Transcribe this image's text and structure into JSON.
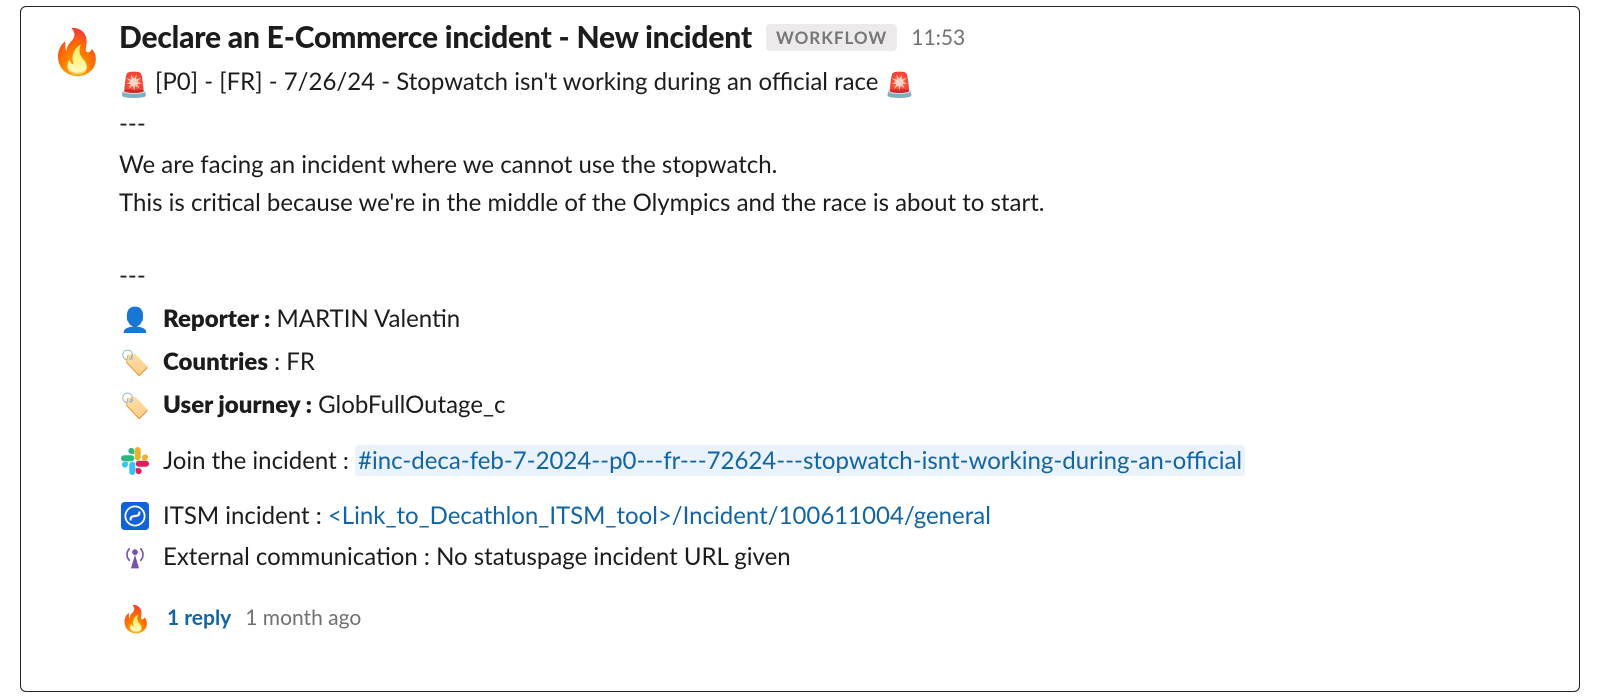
{
  "message": {
    "avatar_emoji": "🔥",
    "title": "Declare an E-Commerce incident - New incident",
    "badge": "WORKFLOW",
    "timestamp": "11:53",
    "siren_emoji": "🚨",
    "incident_line": " [P0] - [FR] - 7/26/24 - Stopwatch isn't working during an official race ",
    "sep": "---",
    "desc_line1": "We are facing an incident where we cannot use the stopwatch.",
    "desc_line2": "This is critical because we're in the middle of the Olympics and the race is about to start.",
    "reporter": {
      "icon": "👤",
      "label": "Reporter :",
      "value": " MARTIN Valentin"
    },
    "countries": {
      "icon": "🏷️",
      "label": "Countries",
      "value": " : FR"
    },
    "user_journey": {
      "icon": "🏷️",
      "label": "User journey :",
      "value": " GlobFullOutage_c"
    },
    "join": {
      "label": "Join the incident : ",
      "channel": "#inc-deca-feb-7-2024--p0---fr---72624---stopwatch-isnt-working-during-an-official"
    },
    "itsm": {
      "label": " ITSM incident :   ",
      "link": "<Link_to_Decathlon_ITSM_tool>/Incident/100611004/general"
    },
    "external": {
      "label": " External communication : ",
      "value": "No statuspage incident URL given"
    }
  },
  "thread": {
    "avatar_emoji": "🔥",
    "reply_count": "1 reply",
    "age": "1 month ago"
  }
}
